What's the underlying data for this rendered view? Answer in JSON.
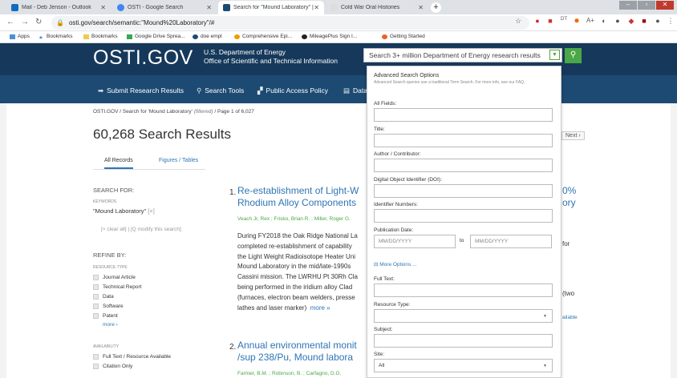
{
  "browser": {
    "tabs": [
      {
        "title": "Mail - Deb Jenson - Outlook",
        "color": "#0f6cbd"
      },
      {
        "title": "OSTI - Google Search",
        "color": "#4285f4"
      },
      {
        "title": "Search for \"Mound Laboratory\" |",
        "color": "#1d4a73"
      },
      {
        "title": "Cold War Oral Histories",
        "color": "#dddddd"
      }
    ],
    "url": "osti.gov/search/semantic:\"Mound%20Laboratory\"/#",
    "bookmarks": [
      "Apps",
      "Bookmarks",
      "Bookmarks",
      "Google Drive Sprea...",
      "doe empl",
      "Comprehensive Epi...",
      "MileagePlus Sign I...",
      "Getting Started"
    ]
  },
  "header": {
    "logo": "OSTI.GOV",
    "dept_line1": "U.S. Department of Energy",
    "dept_line2": "Office of Scientific and Technical Information",
    "search_placeholder": "Search 3+ million Department of Energy research results"
  },
  "nav": [
    "Submit Research Results",
    "Search Tools",
    "Public Access Policy",
    "Data"
  ],
  "breadcrumb": {
    "home": "OSTI.GOV",
    "sep": "/",
    "search": "Search for 'Mound Laboratory'",
    "filtered": "(filtered)",
    "page": "Page 1 of 6,027"
  },
  "results_title": "60,268 Search Results",
  "result_tabs": {
    "all": "All Records",
    "figures": "Figures / Tables"
  },
  "next_label": "Next",
  "sidebar": {
    "search_for": "SEARCH FOR:",
    "keywords_label": "KEYWORDS",
    "keyword": "\"Mound Laboratory\"",
    "remove": "[×]",
    "clear": "[× clear all]",
    "modify": "[Q modify this search]",
    "refine": "REFINE BY:",
    "resource_type_label": "RESOURCE TYPE",
    "resource_types": [
      "Journal Article",
      "Technical Report",
      "Data",
      "Software",
      "Patent"
    ],
    "more": "more",
    "availability_label": "AVAILABILITY",
    "availability": [
      "Full Text / Resource Available",
      "Citation Only"
    ]
  },
  "results": [
    {
      "num": "1.",
      "title_l1": "Re-establishment of Light-W",
      "title_l2": "Rhodium Alloy Components",
      "title_r1": "0%",
      "title_r2": "ory",
      "authors": "Veach Jr, Rex ; Frisko, Brian R. ; Miller, Roger G.",
      "desc": [
        "During FY2018 the Oak Ridge National La",
        "completed re-establishment of capability",
        "the Light Weight Radioisotope Heater Uni",
        "Mound Laboratory in the mid/late-1990s",
        "Cassini mission. The LWRHU Pt 30Rh Cla",
        "being performed in the iridium alloy Clad",
        "(furnaces, electron beam welders, presse"
      ],
      "desc_last": "lathes and laser marker)",
      "more": "more »",
      "right_for": "for",
      "right_two": "(two",
      "right_available": "ailable"
    },
    {
      "num": "2.",
      "title_l1": "Annual environmental monit",
      "title_l2": "/sup 238/Pu, Mound labora",
      "authors": "Farmer, B.M. ; Robinson, B. ; Carfagno, D.G."
    }
  ],
  "adv": {
    "heading": "Advanced Search Options",
    "subtext": "Advanced Search queries use a traditional Term Search. For more info, see our FAQ.",
    "all_fields": "All Fields:",
    "title": "Title:",
    "author": "Author / Contributor:",
    "doi": "Digital Object Identifier (DOI):",
    "identifier": "Identifier Numbers:",
    "pub_date": "Publication Date:",
    "date_placeholder": "MM/DD/YYYY",
    "to": "to",
    "more_options": "More Options ...",
    "full_text": "Full Text:",
    "resource_type": "Resource Type:",
    "subject": "Subject:",
    "site": "Site:",
    "site_value": "All"
  }
}
